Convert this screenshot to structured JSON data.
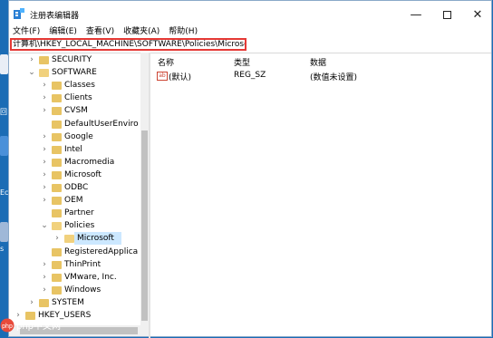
{
  "window": {
    "title": "注册表编辑器"
  },
  "menu": [
    "文件(F)",
    "编辑(E)",
    "查看(V)",
    "收藏夹(A)",
    "帮助(H)"
  ],
  "address": "计算机\\HKEY_LOCAL_MACHINE\\SOFTWARE\\Policies\\Microsoft",
  "tree": [
    {
      "label": "SECURITY",
      "arrow": "›"
    },
    {
      "label": "SOFTWARE",
      "arrow": "⌄"
    },
    {
      "label": "Classes",
      "arrow": "›"
    },
    {
      "label": "Clients",
      "arrow": "›"
    },
    {
      "label": "CVSM",
      "arrow": "›"
    },
    {
      "label": "DefaultUserEnviro",
      "arrow": ""
    },
    {
      "label": "Google",
      "arrow": "›"
    },
    {
      "label": "Intel",
      "arrow": "›"
    },
    {
      "label": "Macromedia",
      "arrow": "›"
    },
    {
      "label": "Microsoft",
      "arrow": "›"
    },
    {
      "label": "ODBC",
      "arrow": "›"
    },
    {
      "label": "OEM",
      "arrow": "›"
    },
    {
      "label": "Partner",
      "arrow": ""
    },
    {
      "label": "Policies",
      "arrow": "⌄"
    },
    {
      "label": "Microsoft",
      "arrow": "›",
      "selected": true
    },
    {
      "label": "RegisteredApplica",
      "arrow": ""
    },
    {
      "label": "ThinPrint",
      "arrow": "›"
    },
    {
      "label": "VMware, Inc.",
      "arrow": "›"
    },
    {
      "label": "Windows",
      "arrow": "›"
    },
    {
      "label": "SYSTEM",
      "arrow": "›"
    },
    {
      "label": "HKEY_USERS",
      "arrow": "›"
    }
  ],
  "columns": [
    "名称",
    "类型",
    "数据"
  ],
  "values": [
    {
      "name": "(默认)",
      "type": "REG_SZ",
      "data": "(数值未设置)"
    }
  ],
  "icons": {
    "string_value": "ab"
  },
  "watermark": "php中文网",
  "desktop_labels": [
    "回",
    "Ec",
    "s"
  ],
  "colors": {
    "highlight": "#e53935",
    "selection": "#cce8ff",
    "folder": "#e8c464"
  }
}
